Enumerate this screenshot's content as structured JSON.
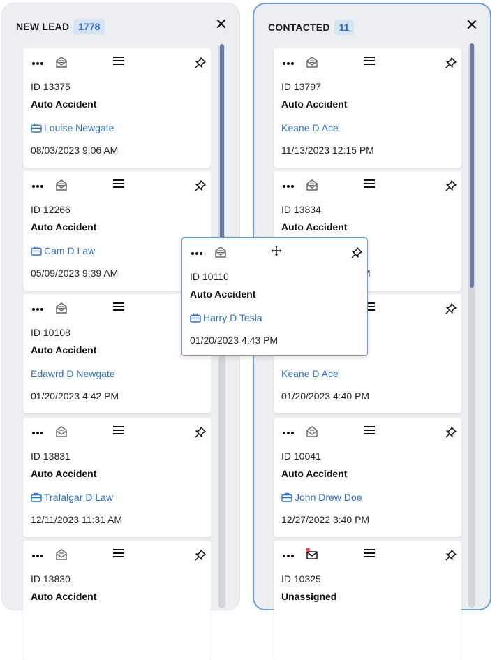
{
  "columns": [
    {
      "title": "NEW LEAD",
      "count": "1778",
      "close_icon": "close-icon",
      "cards": [
        {
          "id": "ID 13375",
          "type": "Auto Accident",
          "contact": "Louise Newgate",
          "has_case_icon": true,
          "date": "08/03/2023 9:06 AM"
        },
        {
          "id": "ID 12266",
          "type": "Auto Accident",
          "contact": "Cam D Law",
          "has_case_icon": true,
          "date": "05/09/2023 9:39 AM"
        },
        {
          "id": "ID 10108",
          "type": "Auto Accident",
          "contact": "Edawrd D Newgate",
          "has_case_icon": false,
          "date": "01/20/2023 4:42 PM"
        },
        {
          "id": "ID 13831",
          "type": "Auto Accident",
          "contact": "Trafalgar D Law",
          "has_case_icon": true,
          "date": "12/11/2023 11:31 AM"
        },
        {
          "id": "ID 13830",
          "type": "Auto Accident",
          "contact": "",
          "has_case_icon": false,
          "date": ""
        }
      ]
    },
    {
      "title": "CONTACTED",
      "count": "11",
      "close_icon": "close-icon",
      "cards": [
        {
          "id": "ID 13797",
          "type": "Auto Accident",
          "contact": "Keane D Ace",
          "has_case_icon": false,
          "date": "11/13/2023 12:15 PM"
        },
        {
          "id": "ID 13834",
          "type": "Auto Accident",
          "contact": "",
          "has_case_icon": false,
          "date": "M"
        },
        {
          "id": "",
          "type": "",
          "contact": "Keane D Ace",
          "has_case_icon": false,
          "date": "01/20/2023 4:40 PM"
        },
        {
          "id": "ID 10041",
          "type": "Auto Accident",
          "contact": "John Drew Doe",
          "has_case_icon": true,
          "date": "12/27/2022 3:40 PM"
        },
        {
          "id": "ID 10325",
          "type": "Unassigned",
          "contact": "",
          "has_case_icon": false,
          "date": "",
          "unread": true
        }
      ]
    }
  ],
  "dragging_card": {
    "id": "ID 10110",
    "type": "Auto Accident",
    "contact": "Harry D Tesla",
    "has_case_icon": true,
    "date": "01/20/2023 4:43 PM"
  },
  "colors": {
    "accent": "#2f72c4",
    "badge_bg": "#d5e3f5",
    "column_bg": "#eceef1",
    "drop_border": "#6e9fd4",
    "scroll_thumb": "#6d7ca5"
  }
}
